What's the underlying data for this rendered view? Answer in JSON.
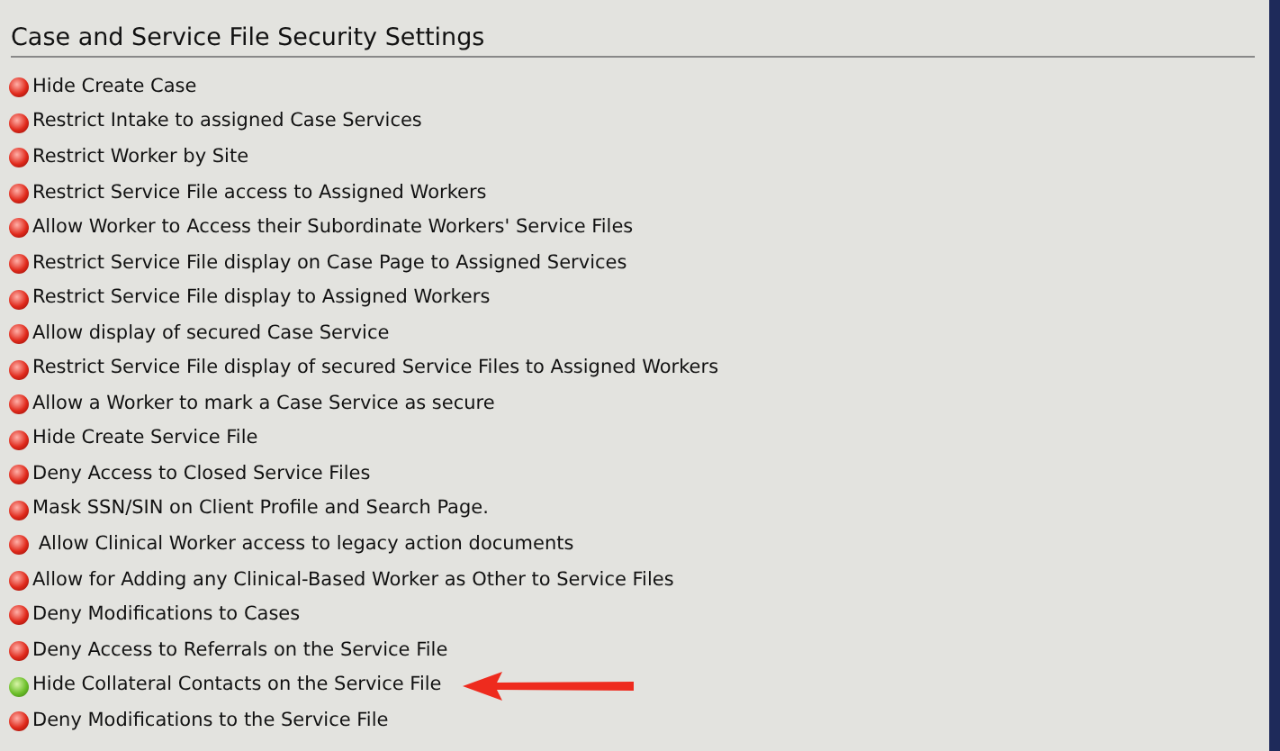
{
  "section": {
    "title": "Case and Service File Security Settings"
  },
  "settings": [
    {
      "label": "Hide Create Case",
      "enabled": false,
      "pointed": false
    },
    {
      "label": "Restrict Intake to assigned Case Services",
      "enabled": false,
      "pointed": false
    },
    {
      "label": "Restrict Worker by Site",
      "enabled": false,
      "pointed": false
    },
    {
      "label": "Restrict Service File access to Assigned Workers",
      "enabled": false,
      "pointed": false
    },
    {
      "label": "Allow Worker to Access their Subordinate Workers' Service Files",
      "enabled": false,
      "pointed": false
    },
    {
      "label": "Restrict Service File display on Case Page to Assigned Services",
      "enabled": false,
      "pointed": false
    },
    {
      "label": "Restrict Service File display to Assigned Workers",
      "enabled": false,
      "pointed": false
    },
    {
      "label": "Allow display of secured Case Service",
      "enabled": false,
      "pointed": false
    },
    {
      "label": "Restrict Service File display of secured Service Files to Assigned Workers",
      "enabled": false,
      "pointed": false
    },
    {
      "label": "Allow a Worker to mark a Case Service as secure",
      "enabled": false,
      "pointed": false
    },
    {
      "label": "Hide Create Service File",
      "enabled": false,
      "pointed": false
    },
    {
      "label": "Deny Access to Closed Service Files",
      "enabled": false,
      "pointed": false
    },
    {
      "label": "Mask SSN/SIN on Client Profile and Search Page.",
      "enabled": false,
      "pointed": false
    },
    {
      "label": " Allow Clinical Worker access to legacy action documents",
      "enabled": false,
      "pointed": false
    },
    {
      "label": "Allow for Adding any Clinical-Based Worker as Other to Service Files",
      "enabled": false,
      "pointed": false
    },
    {
      "label": "Deny Modifications to Cases",
      "enabled": false,
      "pointed": false
    },
    {
      "label": "Deny Access to Referrals on the Service File",
      "enabled": false,
      "pointed": false
    },
    {
      "label": "Hide Collateral Contacts on the Service File",
      "enabled": true,
      "pointed": true
    },
    {
      "label": "Deny Modifications to the Service File",
      "enabled": false,
      "pointed": false
    }
  ]
}
